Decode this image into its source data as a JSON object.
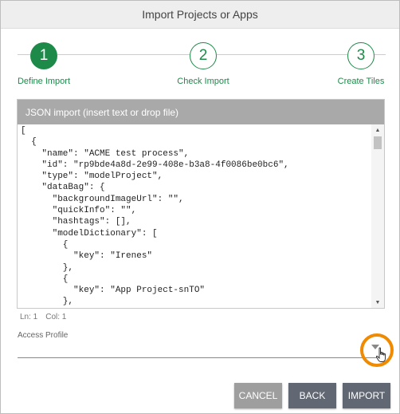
{
  "dialog": {
    "title": "Import Projects or Apps"
  },
  "steps": [
    {
      "number": "1",
      "label": "Define Import",
      "state": "active"
    },
    {
      "number": "2",
      "label": "Check Import",
      "state": "inactive"
    },
    {
      "number": "3",
      "label": "Create Tiles",
      "state": "inactive"
    }
  ],
  "json_import": {
    "title": "JSON import (insert text or drop file)",
    "lines": [
      "[",
      "  {",
      "    \"name\": \"ACME test process\",",
      "    \"id\": \"rp9bde4a8d-2e99-408e-b3a8-4f0086be0bc6\",",
      "    \"type\": \"modelProject\",",
      "    \"dataBag\": {",
      "      \"backgroundImageUrl\": \"\",",
      "      \"quickInfo\": \"\",",
      "      \"hashtags\": [],",
      "      \"modelDictionary\": [",
      "        {",
      "          \"key\": \"Irenes\"",
      "        },",
      "        {",
      "          \"key\": \"App Project-snTO\"",
      "        },",
      "        {"
    ]
  },
  "status": {
    "line": "Ln: 1",
    "col": "Col: 1"
  },
  "access_profile": {
    "label": "Access Profile",
    "value": ""
  },
  "buttons": {
    "cancel": "CANCEL",
    "back": "BACK",
    "import": "IMPORT"
  },
  "colors": {
    "accent": "#1e8a4a",
    "highlight": "#f08a00",
    "button_dark": "#616873",
    "button_disabled": "#9e9e9e"
  },
  "icons": {
    "dropdown": "chevron-down-icon",
    "cursor": "hand-pointer-icon"
  }
}
